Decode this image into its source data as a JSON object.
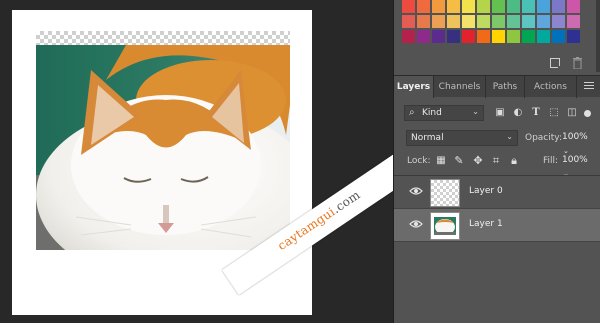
{
  "swatches": {
    "colors": [
      "#ee4b40",
      "#ef6a3e",
      "#f39a3f",
      "#f5bd44",
      "#f4e24a",
      "#b4d549",
      "#63c14f",
      "#4cbb84",
      "#49c1b7",
      "#4aa3db",
      "#7a78c7",
      "#cd56a8",
      "#e35d55",
      "#e67a4d",
      "#eba055",
      "#efc35c",
      "#f2e26b",
      "#bfda61",
      "#7fc86a",
      "#63c397",
      "#5dc5c2",
      "#5fa6dc",
      "#8c85cf",
      "#cd6bb0",
      "#b3214c",
      "#8e2a89",
      "#5b2c8e",
      "#36307f",
      "#e2222c",
      "#f06a18",
      "#ffd400",
      "#8dc63f",
      "#00a651",
      "#00a99d",
      "#0072bc",
      "#2e3192"
    ]
  },
  "panel": {
    "tabs": [
      "Layers",
      "Channels",
      "Paths",
      "Actions"
    ],
    "active_tab": "Layers",
    "filter": {
      "kind_label": "Kind"
    },
    "blend_mode": "Normal",
    "opacity_label": "Opacity:",
    "opacity_value": "100%",
    "lock_label": "Lock:",
    "fill_label": "Fill:",
    "fill_value": "100%",
    "layers": [
      {
        "name": "Layer 0",
        "visible": true,
        "selected": false
      },
      {
        "name": "Layer 1",
        "visible": true,
        "selected": true
      }
    ]
  },
  "watermark": {
    "brand": "caytamgui",
    "tld": ".com"
  }
}
